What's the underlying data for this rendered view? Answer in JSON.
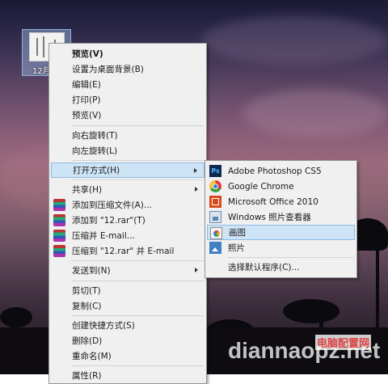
{
  "desktop": {
    "file_label": "12月",
    "watermark_cn": "电脑配置网",
    "watermark_en": "diannaopz.net"
  },
  "context_menu": {
    "items": [
      {
        "label": "预览(V)",
        "bold": true
      },
      {
        "label": "设置为桌面背景(B)"
      },
      {
        "label": "编辑(E)"
      },
      {
        "label": "打印(P)"
      },
      {
        "label": "预览(V)"
      },
      {
        "label": "向右旋转(T)"
      },
      {
        "label": "向左旋转(L)"
      },
      {
        "label": "打开方式(H)",
        "submenu": true
      },
      {
        "label": "共享(H)",
        "submenu": true
      },
      {
        "label": "添加到压缩文件(A)...",
        "icon": "winrar-icon"
      },
      {
        "label": "添加到 \"12.rar\"(T)",
        "icon": "winrar-icon"
      },
      {
        "label": "压缩并 E-mail...",
        "icon": "winrar-icon"
      },
      {
        "label": "压缩到 \"12.rar\" 并 E-mail",
        "icon": "winrar-icon"
      },
      {
        "label": "发送到(N)",
        "submenu": true
      },
      {
        "label": "剪切(T)"
      },
      {
        "label": "复制(C)"
      },
      {
        "label": "创建快捷方式(S)"
      },
      {
        "label": "删除(D)"
      },
      {
        "label": "重命名(M)"
      },
      {
        "label": "属性(R)"
      }
    ]
  },
  "open_with_submenu": {
    "items": [
      {
        "label": "Adobe Photoshop CS5",
        "icon": "photoshop-icon"
      },
      {
        "label": "Google Chrome",
        "icon": "chrome-icon"
      },
      {
        "label": "Microsoft Office 2010",
        "icon": "office-icon"
      },
      {
        "label": "Windows 照片查看器",
        "icon": "photo-viewer-icon"
      },
      {
        "label": "画图",
        "icon": "paint-icon"
      },
      {
        "label": "照片",
        "icon": "photos-icon"
      },
      {
        "label": "选择默认程序(C)..."
      }
    ],
    "highlighted_index": 4
  },
  "colors": {
    "menu_bg": "#f0f0f0",
    "highlight_bg": "#cde3f6",
    "highlight_border": "#8fbbe3"
  }
}
